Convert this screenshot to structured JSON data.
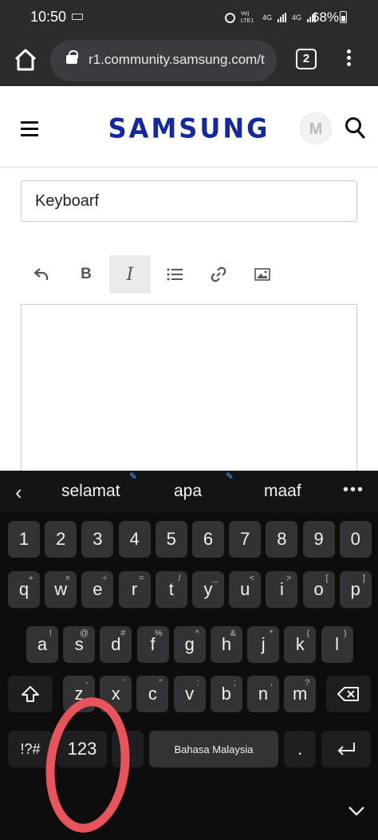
{
  "status_bar": {
    "time": "10:50",
    "network_1": "Vo) LTE1",
    "network_2": "4G",
    "network_3": "4G",
    "battery": "68%"
  },
  "browser": {
    "url": "r1.community.samsung.com/t",
    "tab_count": "2"
  },
  "site": {
    "logo": "SAMSUNG",
    "avatar_letter": "M"
  },
  "editor": {
    "subject_value": "Keyboarf",
    "toolbar": {
      "bold_label": "B",
      "italic_label": "I"
    }
  },
  "keyboard": {
    "suggestions": [
      "selamat",
      "apa",
      "maaf"
    ],
    "number_row": [
      "1",
      "2",
      "3",
      "4",
      "5",
      "6",
      "7",
      "8",
      "9",
      "0"
    ],
    "row1": [
      {
        "k": "q",
        "h": "+"
      },
      {
        "k": "w",
        "h": "×"
      },
      {
        "k": "e",
        "h": "÷"
      },
      {
        "k": "r",
        "h": "="
      },
      {
        "k": "t",
        "h": "/"
      },
      {
        "k": "y",
        "h": "_"
      },
      {
        "k": "u",
        "h": "<"
      },
      {
        "k": "i",
        "h": ">"
      },
      {
        "k": "o",
        "h": "["
      },
      {
        "k": "p",
        "h": "]"
      }
    ],
    "row2": [
      {
        "k": "a",
        "h": "!"
      },
      {
        "k": "s",
        "h": "@"
      },
      {
        "k": "d",
        "h": "#"
      },
      {
        "k": "f",
        "h": "%"
      },
      {
        "k": "g",
        "h": "^"
      },
      {
        "k": "h",
        "h": "&"
      },
      {
        "k": "j",
        "h": "*"
      },
      {
        "k": "k",
        "h": "("
      },
      {
        "k": "l",
        "h": ")"
      }
    ],
    "row3": [
      {
        "k": "z",
        "h": "-"
      },
      {
        "k": "x",
        "h": "'"
      },
      {
        "k": "c",
        "h": "\""
      },
      {
        "k": "v",
        "h": ":"
      },
      {
        "k": "b",
        "h": ";"
      },
      {
        "k": "n",
        "h": ","
      },
      {
        "k": "m",
        "h": "?"
      }
    ],
    "symbols_key": "!?#",
    "numbers_key": "123",
    "space_label": "Bahasa Malaysia",
    "period_key": "."
  },
  "colors": {
    "brand": "#1428a0",
    "annotation": "#e8545b"
  }
}
